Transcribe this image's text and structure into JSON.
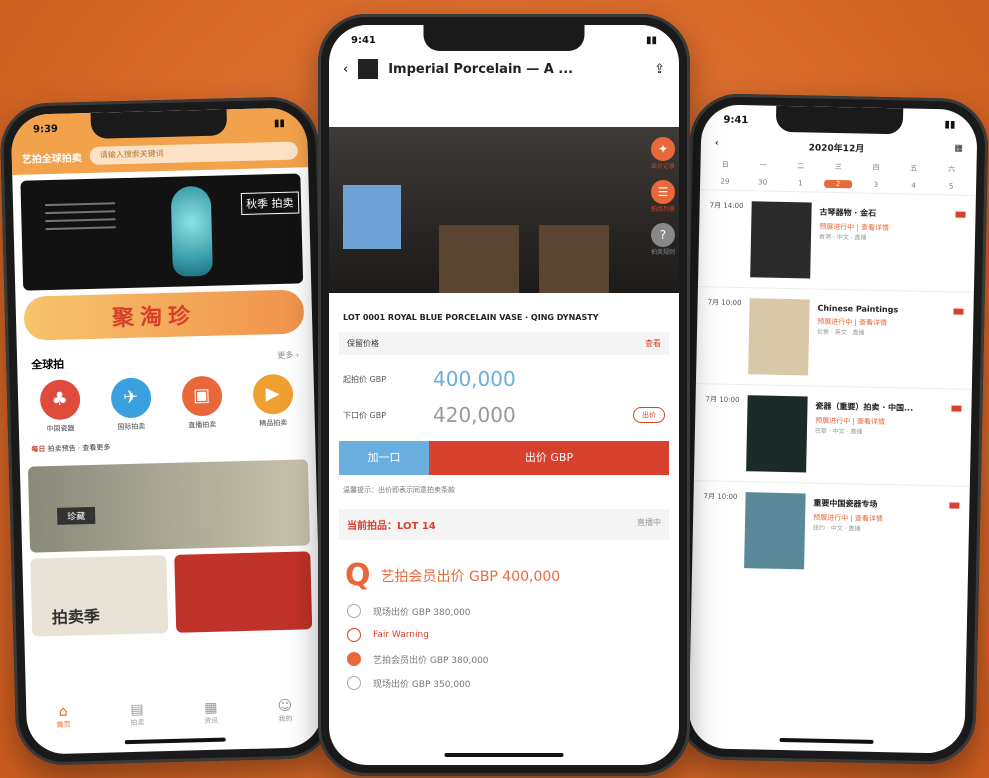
{
  "left_phone": {
    "time": "9:39",
    "brand": "艺拍全球拍卖",
    "search_placeholder": "请输入搜索关键词",
    "banner_title": "秋季 拍卖",
    "promo_text": "聚淘珍",
    "section_title": "全球拍",
    "section_more": "更多 ›",
    "categories": [
      {
        "label": "中国瓷器",
        "color": "#e04a3a"
      },
      {
        "label": "国际拍卖",
        "color": "#3aa0e0"
      },
      {
        "label": "直播拍卖",
        "color": "#e8683a"
      },
      {
        "label": "精品拍卖",
        "color": "#f0a030"
      }
    ],
    "news_tag": "每日",
    "news_text": "拍卖预告 · 查看更多",
    "card_label": "珍藏",
    "tile_text": "拍卖季",
    "tabs": [
      "首页",
      "拍卖",
      "资讯",
      "我的"
    ]
  },
  "middle_phone": {
    "time": "9:41",
    "nav_title": "Imperial Porcelain — A ...",
    "lot_text": "LOT 0001  ROYAL BLUE PORCELAIN VASE · QING DYNASTY",
    "reserve_label": "保留价格",
    "reserve_link": "查看",
    "start_label": "起拍价 GBP",
    "start_price": "400,000",
    "next_label": "下口价 GBP",
    "next_price": "420,000",
    "bid_pill": "出价",
    "btn_left": "加一口",
    "btn_right": "出价 GBP",
    "note": "温馨提示：出价即表示同意拍卖条款",
    "current_lot": "当前拍品：LOT 14",
    "current_right": "直播中",
    "bid_headline": "艺拍会员出价 GBP 400,000",
    "log": [
      {
        "text": "现场出价 GBP 380,000",
        "kind": "normal"
      },
      {
        "text": "Fair Warning",
        "kind": "warn"
      },
      {
        "text": "艺拍会员出价 GBP 380,000",
        "kind": "o"
      },
      {
        "text": "现场出价 GBP 350,000",
        "kind": "normal"
      }
    ],
    "side_buttons": [
      "出价记录",
      "拍品列表",
      "拍卖规则"
    ]
  },
  "right_phone": {
    "time": "9:41",
    "month": "2020年12月",
    "week_days": [
      "日",
      "一",
      "二",
      "三",
      "四",
      "五",
      "六"
    ],
    "week_dates": [
      "29",
      "30",
      "1",
      "2",
      "3",
      "4",
      "5"
    ],
    "items": [
      {
        "time": "7月\n14:00",
        "title": "古琴器物 · 金石",
        "sub": "预展进行中 | 查看详情",
        "meta": "香港 · 中文 · 直播",
        "thumb": "#2a2a2a"
      },
      {
        "time": "7月\n10:00",
        "title": "Chinese Paintings",
        "sub": "预展进行中 | 查看详情",
        "meta": "伦敦 · 英文 · 直播",
        "thumb": "#d9c8a8"
      },
      {
        "time": "7月\n10:00",
        "title": "瓷器（重要）拍卖 · 中国...",
        "sub": "预展进行中 | 查看详情",
        "meta": "巴黎 · 中文 · 直播",
        "thumb": "#1c2a2a"
      },
      {
        "time": "7月\n10:00",
        "title": "重要中国瓷器专场",
        "sub": "预展进行中 | 查看详情",
        "meta": "纽约 · 中文 · 直播",
        "thumb": "#5a8a9a"
      }
    ]
  }
}
